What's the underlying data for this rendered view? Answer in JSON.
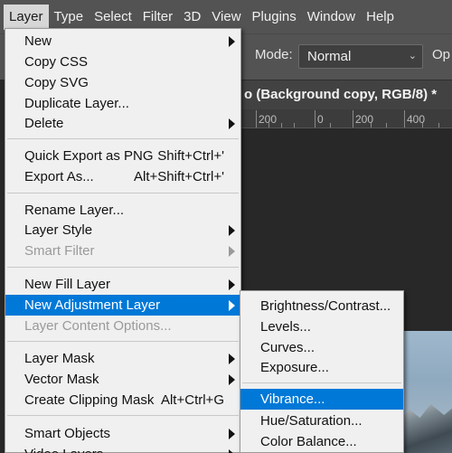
{
  "menubar": {
    "items": [
      "Layer",
      "Type",
      "Select",
      "Filter",
      "3D",
      "View",
      "Plugins",
      "Window",
      "Help"
    ]
  },
  "options": {
    "mode_label": "Mode:",
    "mode_value": "Normal",
    "cut_label": "Op"
  },
  "document": {
    "tab_title": "o (Background copy, RGB/8) *",
    "close_glyph": "×"
  },
  "ruler": {
    "labels": [
      "200",
      "0",
      "200",
      "400"
    ]
  },
  "layer_menu": {
    "new": "New",
    "copy_css": "Copy CSS",
    "copy_svg": "Copy SVG",
    "duplicate_layer": "Duplicate Layer...",
    "delete": "Delete",
    "quick_export": "Quick Export as PNG",
    "quick_export_shortcut": "Shift+Ctrl+'",
    "export_as": "Export As...",
    "export_as_shortcut": "Alt+Shift+Ctrl+'",
    "rename_layer": "Rename Layer...",
    "layer_style": "Layer Style",
    "smart_filter": "Smart Filter",
    "new_fill_layer": "New Fill Layer",
    "new_adjustment_layer": "New Adjustment Layer",
    "layer_content_options": "Layer Content Options...",
    "layer_mask": "Layer Mask",
    "vector_mask": "Vector Mask",
    "create_clipping_mask": "Create Clipping Mask",
    "create_clipping_mask_shortcut": "Alt+Ctrl+G",
    "smart_objects": "Smart Objects",
    "video_layers": "Video Layers"
  },
  "adjustment_submenu": {
    "brightness_contrast": "Brightness/Contrast...",
    "levels": "Levels...",
    "curves": "Curves...",
    "exposure": "Exposure...",
    "vibrance": "Vibrance...",
    "hue_saturation": "Hue/Saturation...",
    "color_balance": "Color Balance..."
  },
  "colors": {
    "menubar_bg": "#535353",
    "menu_bg": "#f0f0f0",
    "highlight": "#0078d7",
    "canvas_bg": "#282828"
  }
}
